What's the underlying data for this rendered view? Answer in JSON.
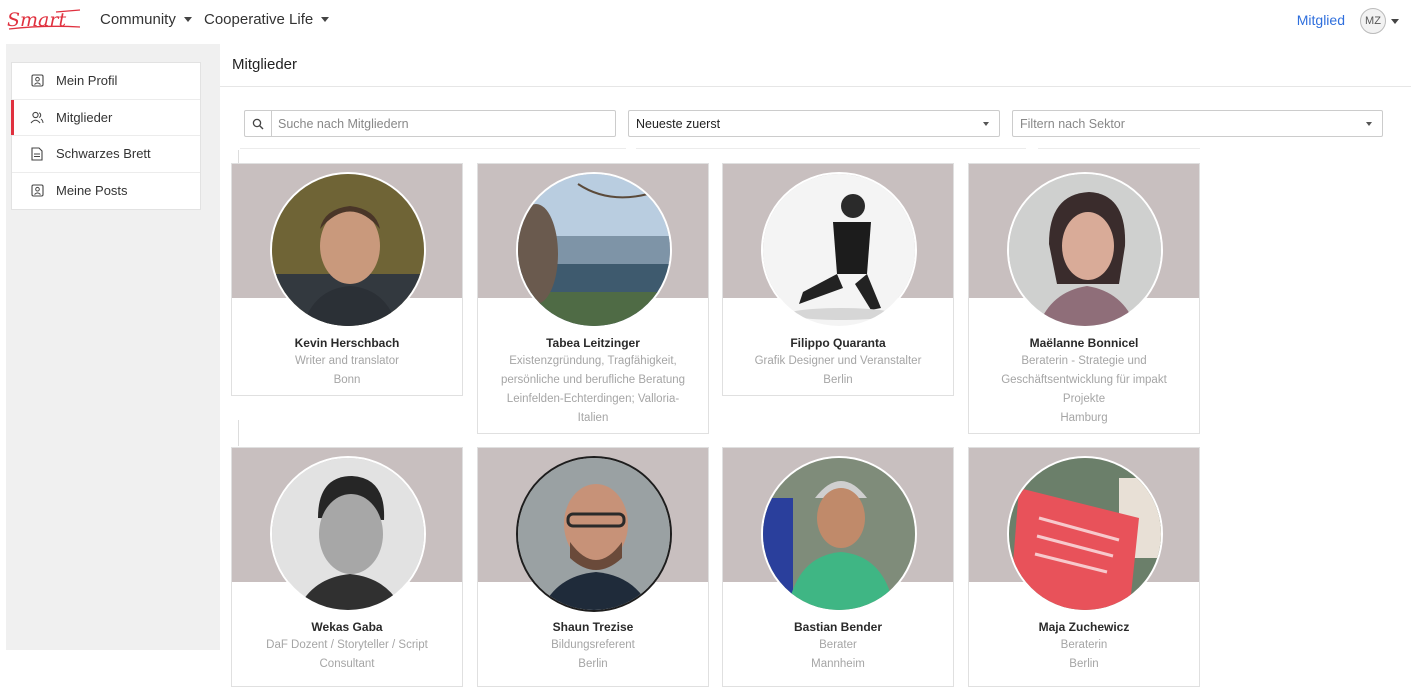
{
  "nav": {
    "logo_text": "Smart",
    "community": "Community",
    "cooperative": "Cooperative Life",
    "role": "Mitglied",
    "avatar_initials": "MZ"
  },
  "sidebar": {
    "items": [
      {
        "label": "Mein Profil",
        "icon": "profile-icon"
      },
      {
        "label": "Mitglieder",
        "icon": "members-icon",
        "active": true
      },
      {
        "label": "Schwarzes Brett",
        "icon": "document-icon"
      },
      {
        "label": "Meine Posts",
        "icon": "posts-icon"
      }
    ]
  },
  "main": {
    "title": "Mitglieder",
    "search_placeholder": "Suche nach Mitgliedern",
    "sort_value": "Neueste zuerst",
    "sector_placeholder": "Filtern nach Sektor"
  },
  "members": [
    {
      "name": "Kevin Herschbach",
      "lines": [
        "Writer and translator",
        "Bonn"
      ]
    },
    {
      "name": "Tabea Leitzinger",
      "lines": [
        "Existenzgründung, Tragfähigkeit,",
        "persönliche und berufliche Beratung",
        "Leinfelden-Echterdingen; Valloria-",
        "Italien"
      ]
    },
    {
      "name": "Filippo Quaranta",
      "lines": [
        "Grafik Designer und Veranstalter",
        "Berlin"
      ]
    },
    {
      "name": "Maëlanne Bonnicel",
      "lines": [
        "Beraterin - Strategie und",
        "Geschäftsentwicklung für impakt",
        "Projekte",
        "Hamburg"
      ]
    },
    {
      "name": "Wekas Gaba",
      "lines": [
        "DaF Dozent / Storyteller / Script",
        "Consultant"
      ]
    },
    {
      "name": "Shaun Trezise",
      "lines": [
        "Bildungsreferent",
        "Berlin"
      ]
    },
    {
      "name": "Bastian Bender",
      "lines": [
        "Berater",
        "Mannheim"
      ]
    },
    {
      "name": "Maja Zuchewicz",
      "lines": [
        "Beraterin",
        "Berlin"
      ]
    }
  ],
  "colors": {
    "brand": "#e0313f",
    "link": "#2f6fdd",
    "banner": "#c8bfbf"
  }
}
